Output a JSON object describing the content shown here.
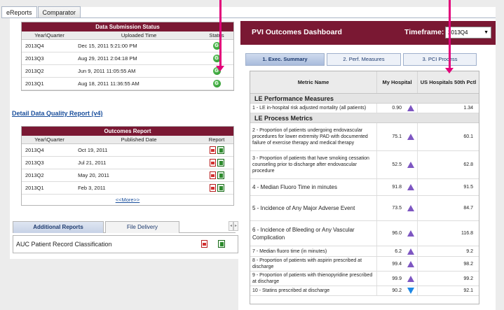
{
  "top_tabs": [
    {
      "label": "eReports",
      "active": true
    },
    {
      "label": "Comparator",
      "active": false
    }
  ],
  "submission": {
    "title": "Data Submission Status",
    "headers": {
      "quarter": "Year\\Quarter",
      "time": "Uploaded Time",
      "status": "Status"
    },
    "rows": [
      {
        "quarter": "2013Q4",
        "time": "Dec 15, 2011 5:21:00 PM",
        "status": "G"
      },
      {
        "quarter": "2013Q3",
        "time": "Aug 29, 2011 2:04:18 PM",
        "status": "G"
      },
      {
        "quarter": "2013Q2",
        "time": "Jun 9, 2011 11:05:55 AM",
        "status": "G"
      },
      {
        "quarter": "2013Q1",
        "time": "Aug 18, 2011 11:36:55 AM",
        "status": "G"
      }
    ]
  },
  "quality_link": "Detail Data Quality Report (v4)",
  "outcomes": {
    "title": "Outcomes Report",
    "headers": {
      "quarter": "Year\\Quarter",
      "date": "Published Date",
      "report": "Report"
    },
    "rows": [
      {
        "quarter": "2013Q4",
        "date": "Oct 19, 2011"
      },
      {
        "quarter": "2013Q3",
        "date": "Jul 21, 2011"
      },
      {
        "quarter": "2013Q2",
        "date": "May 20, 2011"
      },
      {
        "quarter": "2013Q1",
        "date": "Feb 3, 2011"
      }
    ],
    "more": "<<More>>"
  },
  "reports": {
    "tabs": [
      "Additional Reports",
      "File Delivery"
    ],
    "item": "AUC Patient Record Classification"
  },
  "dashboard": {
    "title": "PVI Outcomes Dashboard",
    "timeframe_label": "Timeframe:",
    "timeframe_value": "2013Q4",
    "tabs": [
      "1. Exec. Summary",
      "2. Perf. Measures",
      "3. PCI Process"
    ],
    "headers": {
      "metric": "Metric Name",
      "hospital": "My Hospital",
      "bench": "US Hospitals 50th Pctl"
    },
    "sections": [
      {
        "label": "LE Performance Measures"
      },
      {
        "label": "LE Process Metrics"
      }
    ],
    "metrics": [
      {
        "name": "1 - LE in-hospital risk adjusted mortality (all patients)",
        "value": "0.90",
        "trend": "up",
        "bench": "1.34"
      },
      {
        "name": "2 - Proportion of patients undergoing endovascular procedures for lower extremity PAD with documented failure of exercise therapy and medical therapy",
        "value": "75.1",
        "trend": "up",
        "bench": "60.1"
      },
      {
        "name": "3 - Proportion of patients that have smoking cessation counseling prior to discharge after endovascular procedure",
        "value": "52.5",
        "trend": "up",
        "bench": "62.8"
      },
      {
        "name": "4 - Median Fluoro Time in minutes",
        "value": "91.8",
        "trend": "up",
        "bench": "91.5"
      },
      {
        "name": "5 - Incidence of Any Major Adverse Event",
        "value": "73.5",
        "trend": "up",
        "bench": "84.7"
      },
      {
        "name": "6 - Incidence of Bleeding or Any Vascular Complication",
        "value": "96.0",
        "trend": "up",
        "bench": "116.8"
      },
      {
        "name": "7 - Median fluoro time (in minutes)",
        "value": "6.2",
        "trend": "up",
        "bench": "9.2"
      },
      {
        "name": "8 - Proportion of patients with aspirin prescribed at discharge",
        "value": "99.4",
        "trend": "up",
        "bench": "98.2"
      },
      {
        "name": "9 - Proportion of patients with thienopyridine prescribed at discharge",
        "value": "99.9",
        "trend": "up",
        "bench": "99.2"
      },
      {
        "name": "10 - Statins prescribed at discharge",
        "value": "90.2",
        "trend": "down",
        "bench": "92.1"
      }
    ]
  },
  "colors": {
    "brand": "#7a1833",
    "arrow": "#e2007a",
    "link": "#1a4f9c"
  }
}
